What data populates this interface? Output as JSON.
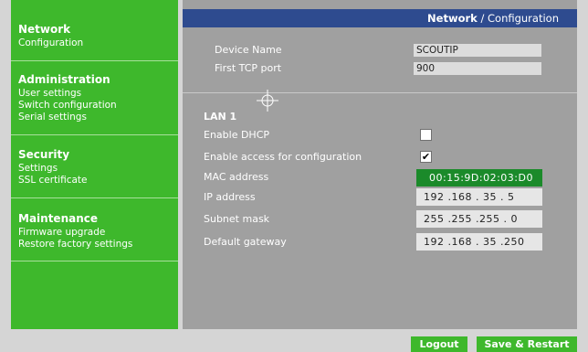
{
  "sidebar": {
    "network": {
      "title": "Network",
      "items": [
        "Configuration"
      ]
    },
    "administration": {
      "title": "Administration",
      "items": [
        "User settings",
        "Switch configuration",
        "Serial settings"
      ]
    },
    "security": {
      "title": "Security",
      "items": [
        "Settings",
        "SSL certificate"
      ]
    },
    "maintenance": {
      "title": "Maintenance",
      "items": [
        "Firmware upgrade",
        "Restore factory settings"
      ]
    }
  },
  "breadcrumb": {
    "section": "Network",
    "separator": " / ",
    "page": "Configuration"
  },
  "device": {
    "name_label": "Device Name",
    "name_value": "SCOUTIP",
    "tcp_label": "First TCP port",
    "tcp_value": "900"
  },
  "lan": {
    "title": "LAN 1",
    "dhcp_label": "Enable DHCP",
    "dhcp_checked": false,
    "access_label": "Enable access for configuration",
    "access_checked": true,
    "checkmark": "✔",
    "mac_label": "MAC address",
    "mac_value": "00:15:9D:02:03:D0",
    "ip_label": "IP address",
    "ip_value": "192 .168 . 35 . 5",
    "subnet_label": "Subnet mask",
    "subnet_value": "255 .255 .255 . 0",
    "gateway_label": "Default gateway",
    "gateway_value": "192 .168 . 35 .250"
  },
  "footer": {
    "logout_label": "Logout",
    "save_label": "Save & Restart"
  },
  "colors": {
    "sidebar": "#3eb82c",
    "header": "#2e4b8f",
    "panel": "#a0a0a0",
    "mac_bg": "#1b8a2a"
  }
}
